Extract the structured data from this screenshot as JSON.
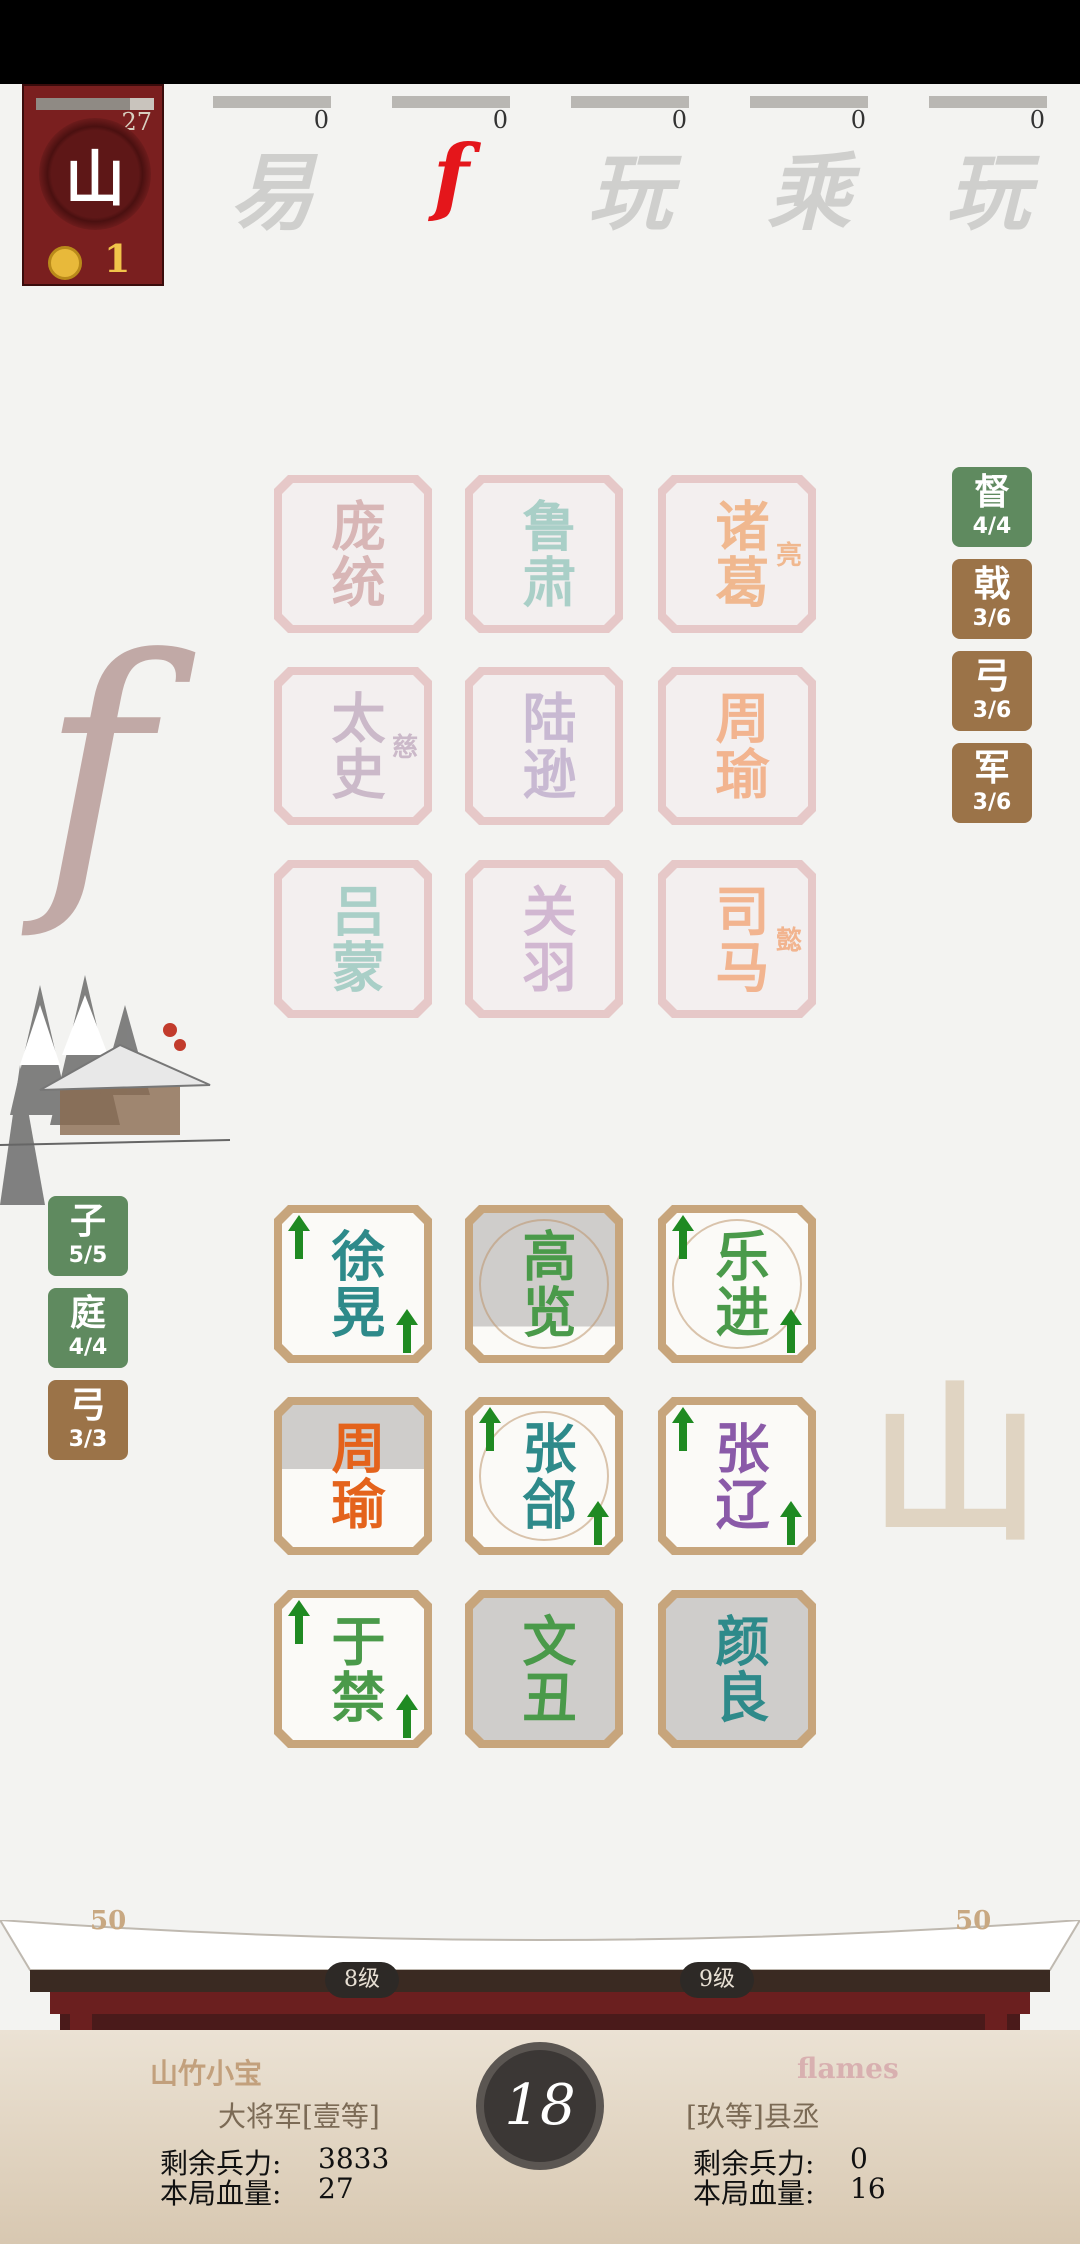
{
  "top_player": {
    "hp": "27",
    "seal": "山",
    "coins": "1",
    "hp_fraction": 0.8
  },
  "opponents": [
    {
      "glyph": "易",
      "score": "0",
      "highlight": false
    },
    {
      "glyph": "f",
      "score": "0",
      "highlight": true
    },
    {
      "glyph": "玩",
      "score": "0",
      "highlight": false
    },
    {
      "glyph": "乘",
      "score": "0",
      "highlight": false
    },
    {
      "glyph": "玩",
      "score": "0",
      "highlight": false
    }
  ],
  "enemy_board": [
    {
      "name": "庞统",
      "sub": "",
      "color": "#d8b6b6"
    },
    {
      "name": "鲁肃",
      "sub": "",
      "color": "#a9cfc7"
    },
    {
      "name": "诸葛",
      "sub": "亮",
      "color": "#f0b88f"
    },
    {
      "name": "太史",
      "sub": "慈",
      "color": "#cbb9c9"
    },
    {
      "name": "陆逊",
      "sub": "",
      "color": "#c8b9d2"
    },
    {
      "name": "周瑜",
      "sub": "",
      "color": "#f2b48f"
    },
    {
      "name": "吕蒙",
      "sub": "",
      "color": "#a9cfc7"
    },
    {
      "name": "关羽",
      "sub": "",
      "color": "#d1b7d1"
    },
    {
      "name": "司马",
      "sub": "懿",
      "color": "#f2b48f"
    }
  ],
  "enemy_badges": [
    {
      "char": "督",
      "count": "4/4",
      "color": "green"
    },
    {
      "char": "戟",
      "count": "3/6",
      "color": "brown"
    },
    {
      "char": "弓",
      "count": "3/6",
      "color": "brown"
    },
    {
      "char": "军",
      "count": "3/6",
      "color": "brown"
    }
  ],
  "my_board": [
    {
      "name": "徐晃",
      "color": "#2e8a8a",
      "arrows": true,
      "style": "plain",
      "ring": false
    },
    {
      "name": "高览",
      "color": "#4a9a4a",
      "arrows": false,
      "style": "topgrey",
      "ring": true
    },
    {
      "name": "乐进",
      "color": "#4a9a4a",
      "arrows": true,
      "style": "plain",
      "ring": true
    },
    {
      "name": "周瑜",
      "color": "#e4631c",
      "arrows": false,
      "style": "half",
      "ring": false
    },
    {
      "name": "张郃",
      "color": "#2e8a8a",
      "arrows": true,
      "style": "plain",
      "ring": true
    },
    {
      "name": "张辽",
      "color": "#8a5aa8",
      "arrows": true,
      "style": "plain",
      "ring": false
    },
    {
      "name": "于禁",
      "color": "#4a9a4a",
      "arrows": true,
      "style": "plain",
      "ring": false
    },
    {
      "name": "文丑",
      "color": "#4a9a4a",
      "arrows": false,
      "style": "grey",
      "ring": false
    },
    {
      "name": "颜良",
      "color": "#2e8a8a",
      "arrows": false,
      "style": "grey",
      "ring": false
    }
  ],
  "my_badges": [
    {
      "char": "子",
      "count": "5/5",
      "color": "green"
    },
    {
      "char": "庭",
      "count": "4/4",
      "color": "green"
    },
    {
      "char": "弓",
      "count": "3/3",
      "color": "brown"
    }
  ],
  "decor": {
    "enemy_glyph": "f",
    "my_glyph": "山"
  },
  "bottom": {
    "left_points": "50",
    "right_points": "50",
    "left_level": "8级",
    "right_level": "9级",
    "timer": "18",
    "me": {
      "name": "山竹小宝",
      "title": "大将军[壹等]",
      "troops_label": "剩余兵力:",
      "troops": "3833",
      "hp_label": "本局血量:",
      "hp": "27"
    },
    "opponent": {
      "name": "flames",
      "title": "[玖等]县丞",
      "troops_label": "剩余兵力:",
      "troops": "0",
      "hp_label": "本局血量:",
      "hp": "16"
    }
  }
}
